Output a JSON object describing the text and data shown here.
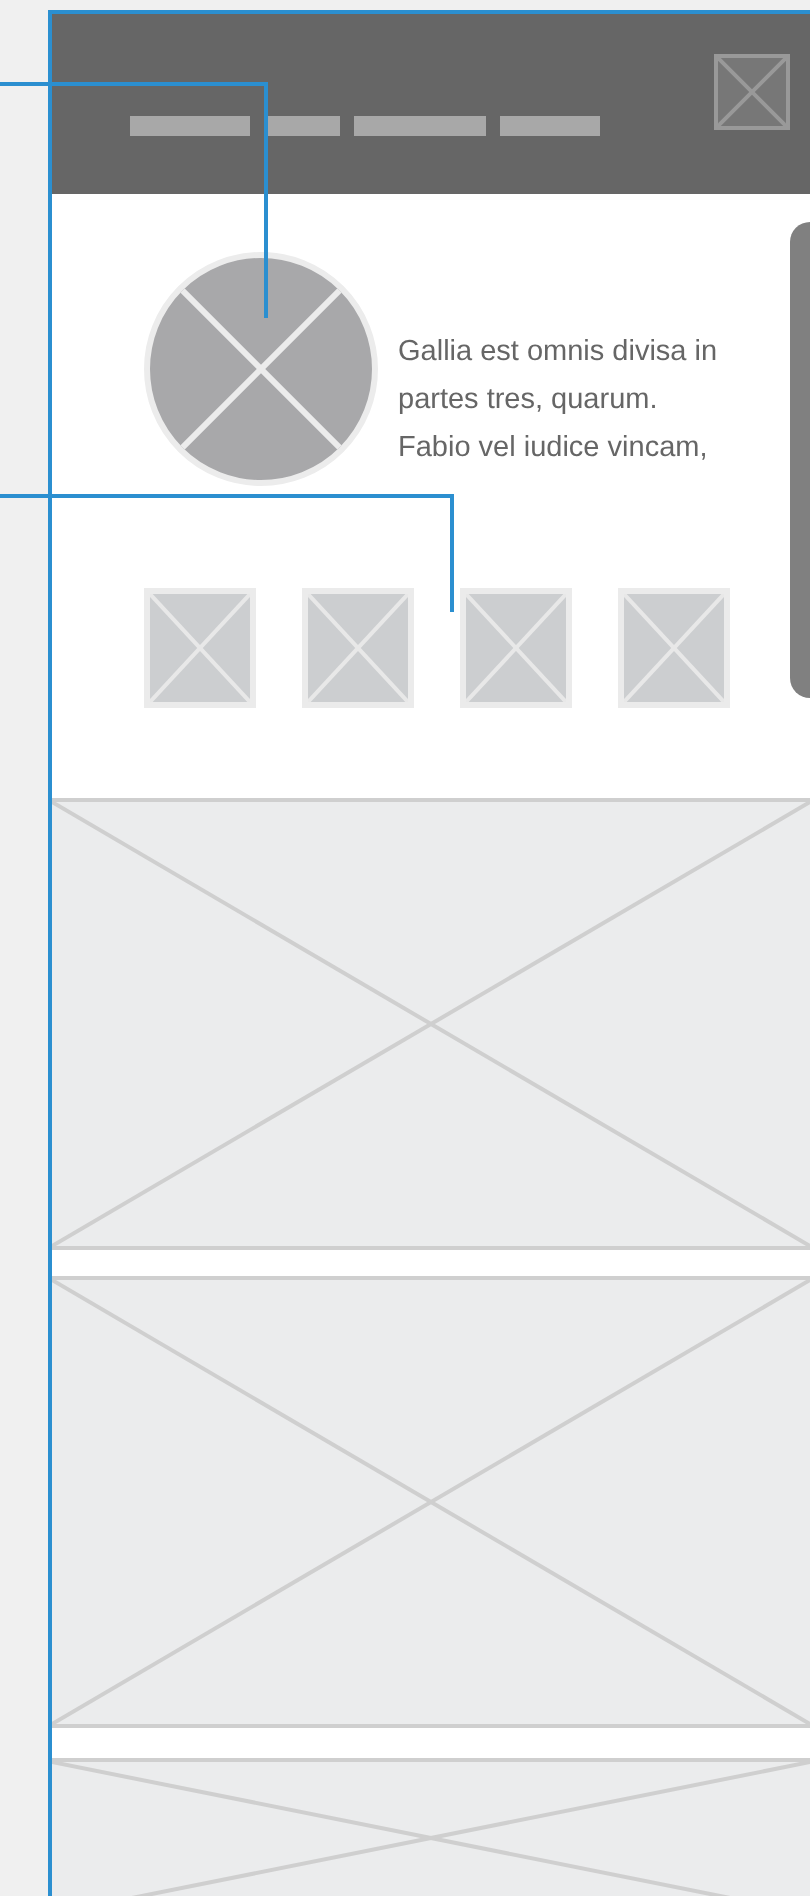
{
  "profile": {
    "text_lines": [
      "Gallia est omnis divisa in",
      "partes tres, quarum.",
      "Fabio vel iudice vincam,"
    ]
  }
}
